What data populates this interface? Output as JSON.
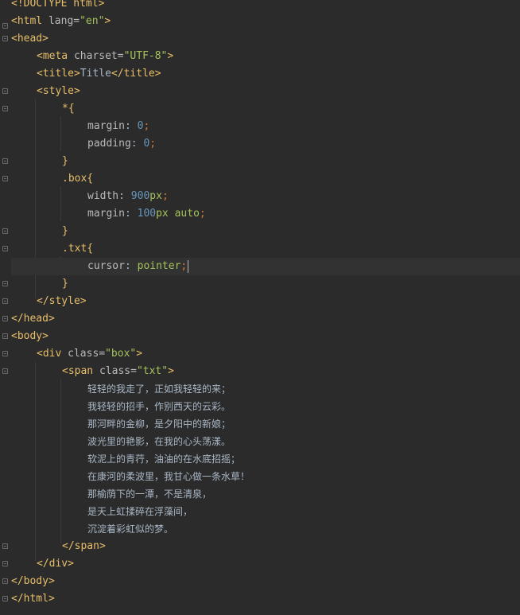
{
  "editor": {
    "lines": [
      "<!DOCTYPE html>",
      "<html lang=\"en\">",
      "<head>",
      "<meta charset=\"UTF-8\">",
      "<title>Title</title>",
      "<style>",
      "*{",
      "margin: 0;",
      "padding: 0;",
      "}",
      ".box{",
      "width: 900px;",
      "margin: 100px auto;",
      "}",
      ".txt{",
      "cursor: pointer;",
      "}",
      "</style>",
      "</head>",
      "<body>",
      "<div class=\"box\">",
      "<span class=\"txt\">",
      "轻轻的我走了，正如我轻轻的来；",
      "我轻轻的招手，作别西天的云彩。",
      "那河畔的金柳，是夕阳中的新娘；",
      "波光里的艳影，在我的心头荡漾。",
      "软泥上的青荇，油油的在水底招摇；",
      "在康河的柔波里，我甘心做一条水草！",
      "那榆荫下的一潭，不是清泉，",
      "是天上虹揉碎在浮藻间，",
      "沉淀着彩虹似的梦。",
      "</span>",
      "</div>",
      "</body>",
      "</html>"
    ],
    "colors": {
      "background": "#2b2b2b",
      "tag": "#e8bf6a",
      "attribute": "#bababa",
      "string": "#a5c25c",
      "number": "#6897bb",
      "punctuation": "#cc7832",
      "text": "#a9b7c6",
      "current_line": "#323232"
    }
  }
}
